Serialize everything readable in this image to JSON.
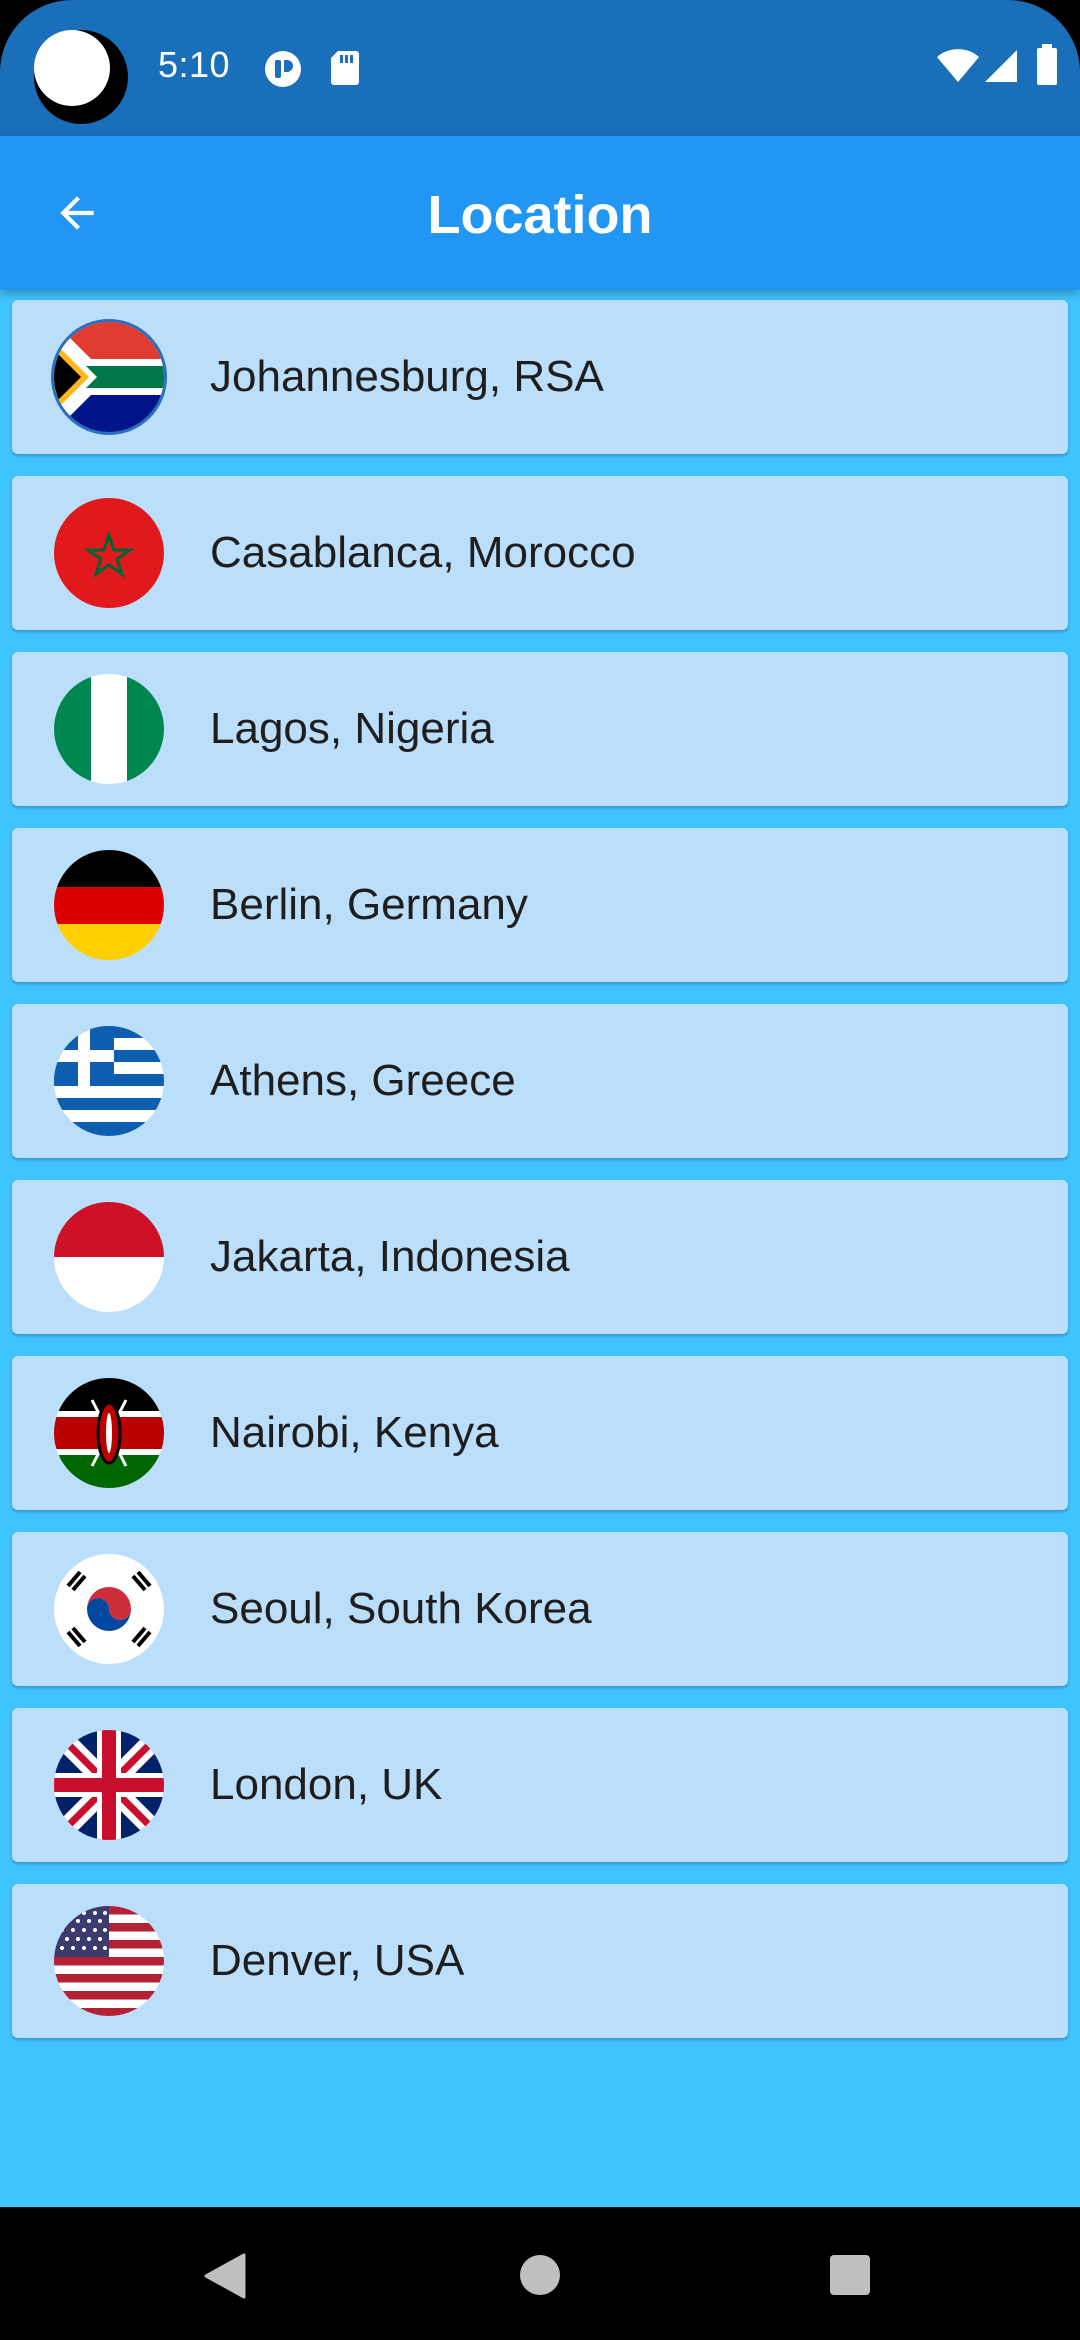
{
  "status_bar": {
    "time": "5:10",
    "left_icons": [
      "app-notification-icon",
      "sd-card-icon"
    ],
    "right_icons": [
      "wifi-icon",
      "cellular-signal-icon",
      "battery-icon"
    ],
    "background": "#1a6fbb"
  },
  "app_bar": {
    "title": "Location",
    "back_icon": "arrow-back-icon",
    "background": "#2196f3"
  },
  "locations": [
    {
      "label": "Johannesburg, RSA",
      "flag": "south-africa-flag-icon"
    },
    {
      "label": "Casablanca, Morocco",
      "flag": "morocco-flag-icon"
    },
    {
      "label": "Lagos, Nigeria",
      "flag": "nigeria-flag-icon"
    },
    {
      "label": "Berlin, Germany",
      "flag": "germany-flag-icon"
    },
    {
      "label": "Athens, Greece",
      "flag": "greece-flag-icon"
    },
    {
      "label": "Jakarta, Indonesia",
      "flag": "indonesia-flag-icon"
    },
    {
      "label": "Nairobi, Kenya",
      "flag": "kenya-flag-icon"
    },
    {
      "label": "Seoul, South Korea",
      "flag": "south-korea-flag-icon"
    },
    {
      "label": "London, UK",
      "flag": "uk-flag-icon"
    },
    {
      "label": "Denver, USA",
      "flag": "usa-flag-icon"
    }
  ],
  "colors": {
    "list_background": "#40c4ff",
    "card_background": "#bbdefb"
  },
  "nav_bar": {
    "icons": [
      "back-triangle-icon",
      "home-circle-icon",
      "recents-square-icon"
    ]
  }
}
